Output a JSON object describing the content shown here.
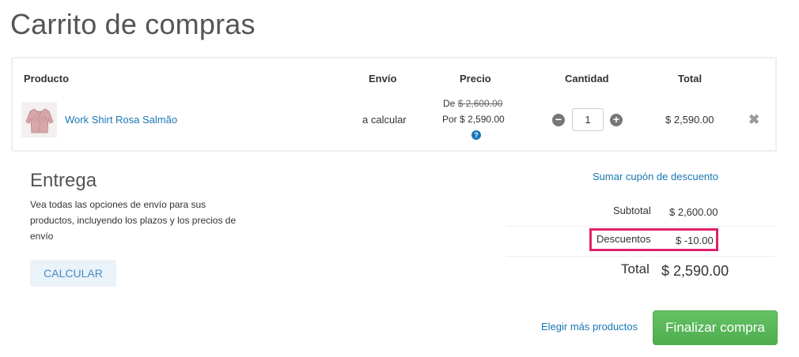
{
  "page": {
    "title": "Carrito de compras"
  },
  "table": {
    "headers": {
      "producto": "Producto",
      "envio": "Envío",
      "precio": "Precio",
      "cantidad": "Cantidad",
      "total": "Total"
    },
    "item": {
      "name": "Work Shirt Rosa Salmão",
      "envio": "a calcular",
      "precio_de_label": "De",
      "precio_de_value": "$ 2,600.00",
      "precio_por": "Por $ 2,590.00",
      "quantity": "1",
      "total": "$ 2,590.00"
    }
  },
  "entrega": {
    "title": "Entrega",
    "description": "Vea todas las opciones de envío para sus productos, incluyendo los plazos y los precios de envío",
    "button": "CALCULAR"
  },
  "summary": {
    "coupon_link": "Sumar cupón de descuento",
    "subtotal_label": "Subtotal",
    "subtotal_value": "$ 2,600.00",
    "descuentos_label": "Descuentos",
    "descuentos_value": "$ -10.00",
    "total_label": "Total",
    "total_value": "$ 2,590.00"
  },
  "actions": {
    "elegir": "Elegir más productos",
    "finalizar": "Finalizar compra"
  },
  "colors": {
    "link": "#1a77b5",
    "highlight": "#e0216a",
    "primary_button": "#5cb85c"
  }
}
